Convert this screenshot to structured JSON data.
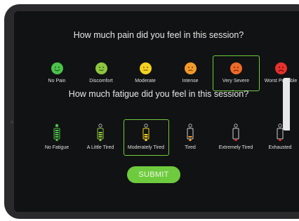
{
  "pain": {
    "question": "How much pain did you feel in this session?",
    "options": [
      {
        "label": "No Pain",
        "color": "#4cc24a"
      },
      {
        "label": "Discomfort",
        "color": "#8dc63f"
      },
      {
        "label": "Moderate",
        "color": "#f4d21f"
      },
      {
        "label": "Intense",
        "color": "#f39a2a"
      },
      {
        "label": "Very Severe",
        "color": "#f26a28",
        "selected": true
      },
      {
        "label": "Worst Possible",
        "color": "#e8312d"
      }
    ]
  },
  "fatigue": {
    "question": "How much fatigue did you feel in this session?",
    "options": [
      {
        "label": "No Fatigue",
        "level": 5,
        "color": "#4cc24a"
      },
      {
        "label": "A Little Tired",
        "level": 4,
        "color": "#8dc63f"
      },
      {
        "label": "Moderately Tired",
        "level": 3,
        "color": "#f4d21f",
        "selected": true
      },
      {
        "label": "Tired",
        "level": 2,
        "color": "#f39a2a"
      },
      {
        "label": "Extremely Tired",
        "level": 1,
        "color": "#e8312d"
      },
      {
        "label": "Exhausted",
        "level": 0,
        "color": "#e8312d"
      }
    ]
  },
  "submit_label": "SUBMIT",
  "accent": "#6fcb3e"
}
